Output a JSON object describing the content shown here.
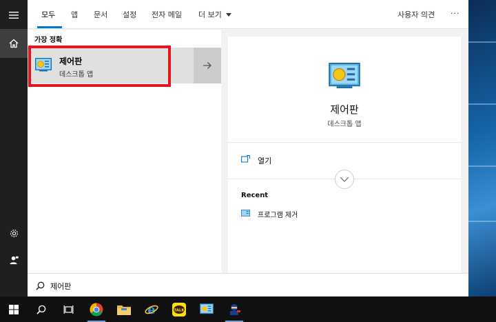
{
  "tabs": [
    {
      "label": "모두",
      "active": true
    },
    {
      "label": "앱"
    },
    {
      "label": "문서"
    },
    {
      "label": "설정"
    },
    {
      "label": "전자 메일"
    },
    {
      "label": "더 보기"
    }
  ],
  "feedback_label": "사용자 의견",
  "more_options_label": "···",
  "best_match": {
    "section_label": "가장 정확",
    "title": "제어판",
    "subtitle": "데스크톱 앱"
  },
  "detail": {
    "title": "제어판",
    "subtitle": "데스크톱 앱",
    "open_label": "열기",
    "recent_label": "Recent",
    "recent_items": [
      "프로그램 제거"
    ]
  },
  "search": {
    "query": "제어판"
  },
  "colors": {
    "accent": "#0078d7",
    "highlight_border": "#e8141c",
    "taskbar": "#101010",
    "rail": "#1f1f1f"
  },
  "icons": {
    "rail": [
      "hamburger-icon",
      "home-icon",
      "settings-gear-icon",
      "user-account-icon"
    ],
    "taskbar": [
      "windows-start-icon",
      "search-icon",
      "task-view-icon",
      "chrome-icon",
      "file-explorer-icon",
      "internet-explorer-icon",
      "kakaotalk-icon",
      "control-panel-icon",
      "app-icon"
    ],
    "kakaotalk_text": "TALK"
  }
}
